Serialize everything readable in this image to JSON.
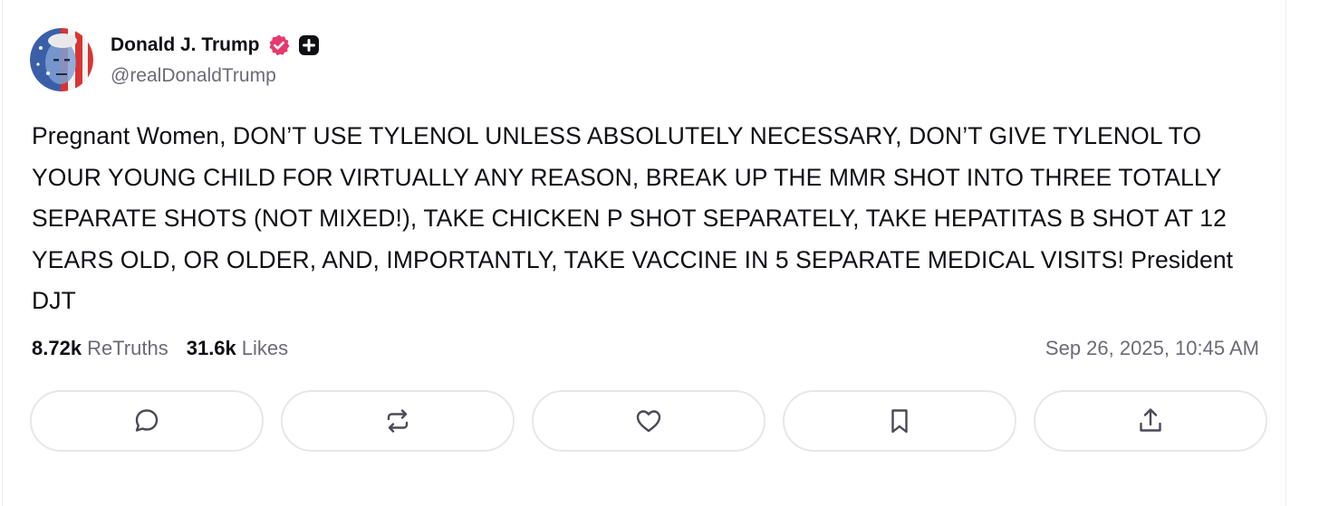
{
  "post": {
    "author_name": "Donald J. Trump",
    "handle": "@realDonaldTrump",
    "body": "Pregnant Women, DON’T USE TYLENOL UNLESS ABSOLUTELY NECESSARY, DON’T GIVE TYLENOL TO YOUR YOUNG CHILD FOR VIRTUALLY ANY REASON, BREAK UP THE MMR SHOT INTO THREE TOTALLY SEPARATE SHOTS (NOT MIXED!), TAKE CHICKEN P SHOT SEPARATELY, TAKE HEPATITAS B SHOT AT 12 YEARS OLD, OR OLDER, AND, IMPORTANTLY, TAKE VACCINE IN 5 SEPARATE MEDICAL VISITS! President DJT",
    "timestamp": "Sep 26, 2025, 10:45 AM"
  },
  "stats": {
    "retruths_count": "8.72k",
    "retruths_label": "ReTruths",
    "likes_count": "31.6k",
    "likes_label": "Likes"
  },
  "actions": [
    {
      "icon": "reply-icon"
    },
    {
      "icon": "retruth-icon"
    },
    {
      "icon": "like-icon"
    },
    {
      "icon": "bookmark-icon"
    },
    {
      "icon": "share-icon"
    }
  ],
  "colors": {
    "verified_badge": "#e5396e",
    "muted_text": "#6b6b76",
    "border": "#e7e7ea",
    "icon": "#4a4a55"
  }
}
